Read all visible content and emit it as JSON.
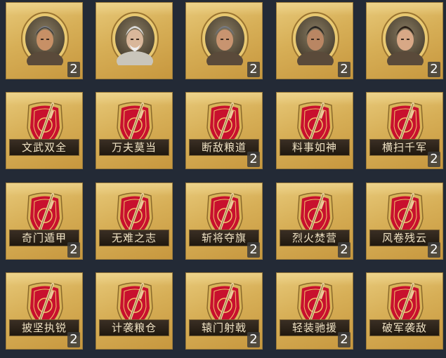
{
  "rows": [
    [
      {
        "kind": "hero",
        "icon": "armored-general-portrait-icon",
        "count": ""
      },
      {
        "kind": "hero",
        "icon": "elderly-strategist-portrait-icon",
        "count": ""
      },
      {
        "kind": "hero",
        "icon": "helmeted-general-portrait-icon",
        "count": ""
      },
      {
        "kind": "hero",
        "icon": "bearded-warrior-portrait-icon",
        "count": ""
      },
      {
        "kind": "hero",
        "icon": "young-general-portrait-icon",
        "count": ""
      }
    ],
    [
      {
        "kind": "tactic",
        "icon": "red-shield-sword-icon",
        "label": "文武双全",
        "count": ""
      },
      {
        "kind": "tactic",
        "icon": "red-shield-sword-icon",
        "label": "万夫莫当",
        "count": ""
      },
      {
        "kind": "tactic",
        "icon": "red-shield-sword-icon",
        "label": "断敌粮道",
        "count": "2"
      },
      {
        "kind": "tactic",
        "icon": "red-shield-sword-icon",
        "label": "料事如神",
        "count": ""
      },
      {
        "kind": "tactic",
        "icon": "red-shield-sword-icon",
        "label": "横扫千军",
        "count": "2"
      }
    ],
    [
      {
        "kind": "tactic",
        "icon": "red-shield-sword-icon",
        "label": "奇门遁甲",
        "count": "2"
      },
      {
        "kind": "tactic",
        "icon": "red-shield-sword-icon",
        "label": "无难之志",
        "count": ""
      },
      {
        "kind": "tactic",
        "icon": "red-shield-sword-icon",
        "label": "斩将夺旗",
        "count": "2"
      },
      {
        "kind": "tactic",
        "icon": "red-shield-sword-icon",
        "label": "烈火焚营",
        "count": "2"
      },
      {
        "kind": "tactic",
        "icon": "red-shield-sword-icon",
        "label": "风卷残云",
        "count": "2"
      }
    ],
    [
      {
        "kind": "tactic",
        "icon": "red-shield-sword-icon",
        "label": "披坚执锐",
        "count": "2"
      },
      {
        "kind": "tactic",
        "icon": "red-shield-sword-icon",
        "label": "计袭粮仓",
        "count": ""
      },
      {
        "kind": "tactic",
        "icon": "red-shield-sword-icon",
        "label": "辕门射戟",
        "count": "2"
      },
      {
        "kind": "tactic",
        "icon": "red-shield-sword-icon",
        "label": "轻装驰援",
        "count": "2"
      },
      {
        "kind": "tactic",
        "icon": "red-shield-sword-icon",
        "label": "破军袭敌",
        "count": ""
      }
    ]
  ],
  "hero_counts": [
    "2",
    "",
    "2",
    "2",
    "2"
  ],
  "colors": {
    "background": "#232a36",
    "card_gold": "#d7af57",
    "shield_red": "#c8102e",
    "shield_gold_rim": "#d9b45a",
    "label_dark": "#2a2119",
    "label_text": "#efe2c4"
  }
}
